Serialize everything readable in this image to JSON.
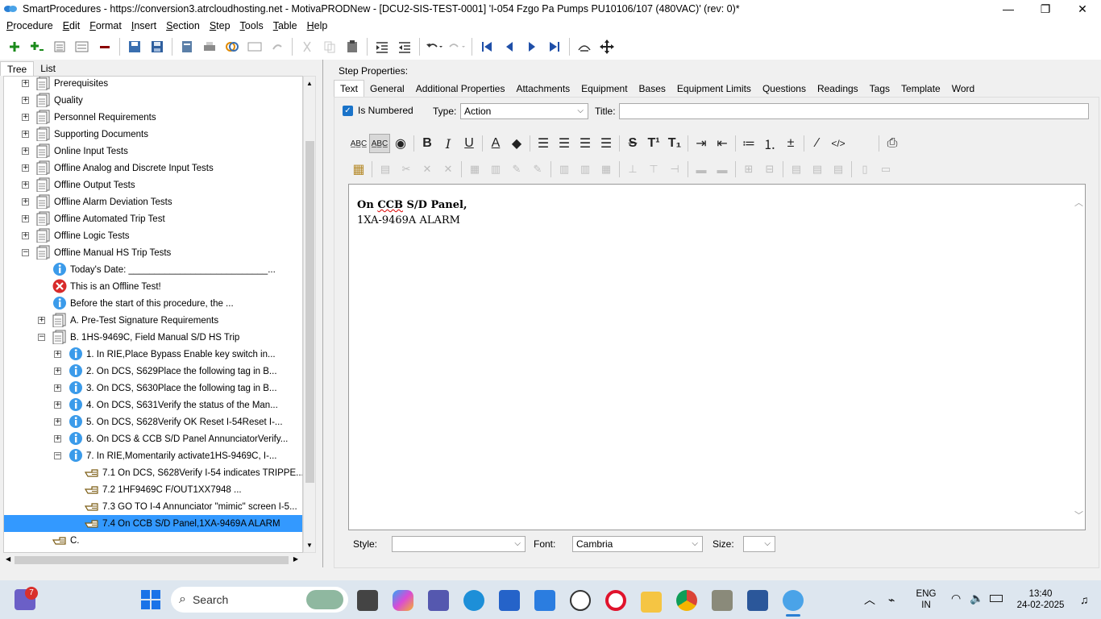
{
  "window": {
    "title": "SmartProcedures - https://conversion3.atrcloudhosting.net - MotivaPRODNew - [DCU2-SIS-TEST-0001] 'I-054 Fzgo Pa Pumps PU10106/107 (480VAC)' (rev: 0)*",
    "minimize": "—",
    "restore": "❐",
    "close": "✕"
  },
  "menu": [
    "Procedure",
    "Edit",
    "Format",
    "Insert",
    "Section",
    "Step",
    "Tools",
    "Table",
    "Help"
  ],
  "left_tabs": [
    "Tree",
    "List"
  ],
  "tree": [
    {
      "label": "Prerequisites",
      "indent": 0,
      "icon": "section",
      "exp": "+"
    },
    {
      "label": "Quality",
      "indent": 0,
      "icon": "section",
      "exp": "+"
    },
    {
      "label": "Personnel Requirements",
      "indent": 0,
      "icon": "section",
      "exp": "+"
    },
    {
      "label": "Supporting Documents",
      "indent": 0,
      "icon": "section",
      "exp": "+"
    },
    {
      "label": "Online Input Tests",
      "indent": 0,
      "icon": "section",
      "exp": "+"
    },
    {
      "label": "Offline Analog and Discrete Input Tests",
      "indent": 0,
      "icon": "section",
      "exp": "+"
    },
    {
      "label": "Offline Output Tests",
      "indent": 0,
      "icon": "section",
      "exp": "+"
    },
    {
      "label": "Offline Alarm Deviation Tests",
      "indent": 0,
      "icon": "section",
      "exp": "+"
    },
    {
      "label": "Offline Automated Trip Test",
      "indent": 0,
      "icon": "section",
      "exp": "+"
    },
    {
      "label": "Offline Logic Tests",
      "indent": 0,
      "icon": "section",
      "exp": "+"
    },
    {
      "label": "Offline Manual HS Trip Tests",
      "indent": 0,
      "icon": "section",
      "exp": "−"
    },
    {
      "label": "Today's Date: ___________________________...",
      "indent": 1,
      "icon": "info",
      "exp": ""
    },
    {
      "label": "This is an Offline Test!",
      "indent": 1,
      "icon": "error",
      "exp": ""
    },
    {
      "label": "Before the start of this procedure, the ...",
      "indent": 1,
      "icon": "info",
      "exp": ""
    },
    {
      "label": "A. Pre-Test Signature Requirements",
      "indent": 1,
      "icon": "section",
      "exp": "+"
    },
    {
      "label": "B. 1HS-9469C, Field Manual S/D HS Trip",
      "indent": 1,
      "icon": "section",
      "exp": "−"
    },
    {
      "label": "1. In RIE,Place Bypass Enable key switch in...",
      "indent": 2,
      "icon": "info",
      "exp": "+"
    },
    {
      "label": "2. On DCS, S629Place the following tag in B...",
      "indent": 2,
      "icon": "info",
      "exp": "+"
    },
    {
      "label": "3. On DCS, S630Place the following tag in B...",
      "indent": 2,
      "icon": "info",
      "exp": "+"
    },
    {
      "label": "4. On DCS, S631Verify the status of the Man...",
      "indent": 2,
      "icon": "info",
      "exp": "+"
    },
    {
      "label": "5. On DCS, S628Verify OK Reset I-54Reset I-...",
      "indent": 2,
      "icon": "info",
      "exp": "+"
    },
    {
      "label": "6. On DCS & CCB S/D Panel AnnunciatorVerify...",
      "indent": 2,
      "icon": "info",
      "exp": "+"
    },
    {
      "label": "7. In RIE,Momentarily activate1HS-9469C, I-...",
      "indent": 2,
      "icon": "info",
      "exp": "−"
    },
    {
      "label": "7.1 On DCS, S628Verify I-54 indicates TRIPPE...",
      "indent": 3,
      "icon": "hand",
      "exp": ""
    },
    {
      "label": "7.2 1HF9469C          F/OUT1XX7948          ...",
      "indent": 3,
      "icon": "hand",
      "exp": ""
    },
    {
      "label": "7.3 GO TO I-4 Annunciator \"mimic\" screen I-5...",
      "indent": 3,
      "icon": "hand",
      "exp": ""
    },
    {
      "label": "7.4 On CCB S/D Panel,1XA-9469A ALARM",
      "indent": 3,
      "icon": "hand",
      "exp": "",
      "selected": true
    },
    {
      "label": "C.",
      "indent": 1,
      "icon": "hand",
      "exp": ""
    }
  ],
  "right": {
    "header": "Step Properties:",
    "tabs": [
      "Text",
      "General",
      "Additional Properties",
      "Attachments",
      "Equipment",
      "Bases",
      "Equipment Limits",
      "Questions",
      "Readings",
      "Tags",
      "Template",
      "Word"
    ],
    "is_numbered_label": "Is Numbered",
    "type_label": "Type:",
    "type_value": "Action",
    "title_label": "Title:",
    "title_value": "",
    "editor_line1_a": "On ",
    "editor_line1_b": "CCB",
    "editor_line1_c": " S/D Panel,",
    "editor_line2": "1XA-9469A ALARM",
    "style_label": "Style:",
    "style_value": "",
    "font_label": "Font:",
    "font_value": "Cambria",
    "size_label": "Size:",
    "size_value": ""
  },
  "taskbar": {
    "search_placeholder": "Search",
    "notif_badge": "7",
    "lang1": "ENG",
    "lang2": "IN",
    "time": "13:40",
    "date": "24-02-2025"
  }
}
